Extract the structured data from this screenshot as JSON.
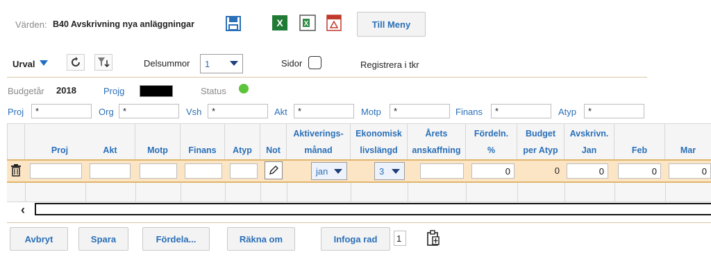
{
  "header": {
    "value_label": "Värden:",
    "value_text": "B40 Avskrivning nya anläggningar",
    "menu_button": "Till Meny"
  },
  "toolbar": {
    "urval": "Urval",
    "delsummor_label": "Delsummor",
    "delsummor_value": "1",
    "sidor_label": "Sidor",
    "register_text": "Registrera i tkr"
  },
  "info": {
    "budget_year_label": "Budgetår",
    "budget_year": "2018",
    "projg_label": "Projg",
    "status_label": "Status",
    "status_color": "#5cc43a"
  },
  "filters": [
    {
      "label": "Proj",
      "value": "*"
    },
    {
      "label": "Org",
      "value": "*"
    },
    {
      "label": "Vsh",
      "value": "*"
    },
    {
      "label": "Akt",
      "value": "*"
    },
    {
      "label": "Motp",
      "value": "*"
    },
    {
      "label": "Finans",
      "value": "*"
    },
    {
      "label": "Atyp",
      "value": "*"
    }
  ],
  "table": {
    "columns": [
      {
        "line1": "",
        "line2": "Proj"
      },
      {
        "line1": "",
        "line2": "Akt"
      },
      {
        "line1": "",
        "line2": "Motp"
      },
      {
        "line1": "",
        "line2": "Finans"
      },
      {
        "line1": "",
        "line2": "Atyp"
      },
      {
        "line1": "",
        "line2": "Not"
      },
      {
        "line1": "Aktiverings-",
        "line2": "månad"
      },
      {
        "line1": "Ekonomisk",
        "line2": "livslängd"
      },
      {
        "line1": "Årets",
        "line2": "anskaffning"
      },
      {
        "line1": "Fördeln.",
        "line2": "%"
      },
      {
        "line1": "Budget",
        "line2": "per Atyp"
      },
      {
        "line1": "Avskrivn.",
        "line2": "Jan"
      },
      {
        "line1": "",
        "line2": "Feb"
      },
      {
        "line1": "",
        "line2": "Mar"
      }
    ],
    "row": {
      "month": "jan",
      "lifetime": "3",
      "fordeln": "0",
      "budget_per_atyp": "0",
      "jan": "0",
      "feb": "0",
      "mar": "0"
    }
  },
  "footer": {
    "cancel": "Avbryt",
    "save": "Spara",
    "distribute": "Fördela...",
    "recalc": "Räkna om",
    "insert_row": "Infoga rad",
    "insert_count": "1"
  }
}
